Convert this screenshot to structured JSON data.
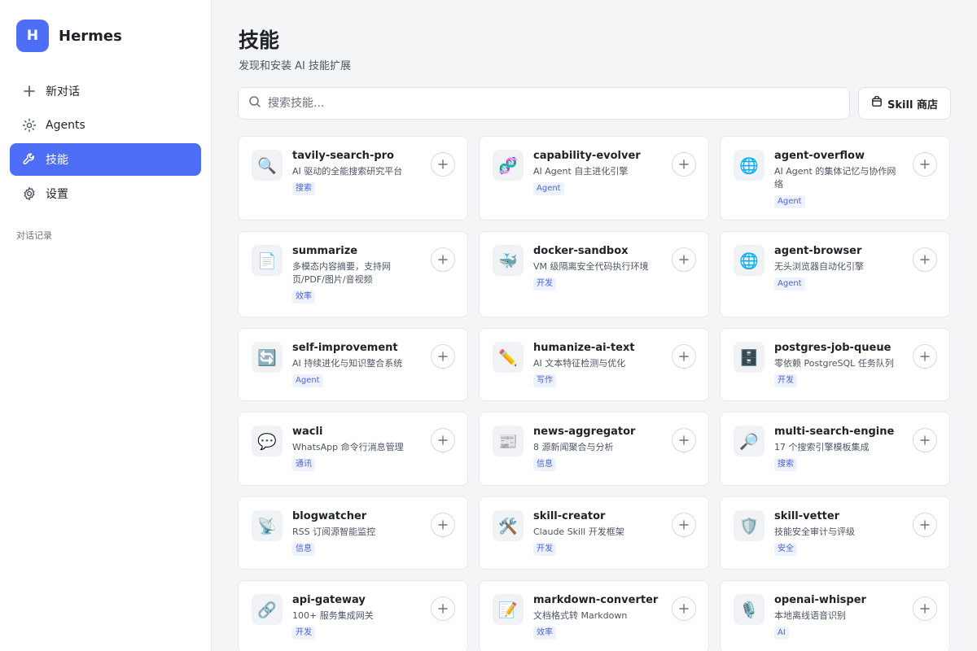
{
  "brand": {
    "logo_letter": "H",
    "name": "Hermes"
  },
  "nav": {
    "items": [
      {
        "label": "新对话",
        "icon": "plus-icon"
      },
      {
        "label": "Agents",
        "icon": "sun-icon"
      },
      {
        "label": "技能",
        "icon": "wrench-icon",
        "active": true
      },
      {
        "label": "设置",
        "icon": "gear-icon"
      }
    ],
    "history_label": "对话记录"
  },
  "page": {
    "title": "技能",
    "subtitle": "发现和安装 AI 技能扩展"
  },
  "search": {
    "placeholder": "搜索技能..."
  },
  "store_button": {
    "label": "Skill 商店"
  },
  "colors": {
    "accent": "#4f6ef7",
    "tag_bg": "#eef1fe",
    "tag_text": "#4a63d8"
  },
  "skills": [
    {
      "name": "tavily-search-pro",
      "desc": "AI 驱动的全能搜索研究平台",
      "tag": "搜索",
      "icon": "🔍",
      "icon_name": "magnifier-icon"
    },
    {
      "name": "capability-evolver",
      "desc": "AI Agent 自主进化引擎",
      "tag": "Agent",
      "icon": "🧬",
      "icon_name": "dna-icon"
    },
    {
      "name": "agent-overflow",
      "desc": "AI Agent 的集体记忆与协作网络",
      "tag": "Agent",
      "icon": "🌐",
      "icon_name": "globe-icon"
    },
    {
      "name": "summarize",
      "desc": "多模态内容摘要，支持网页/PDF/图片/音视频",
      "tag": "效率",
      "icon": "📄",
      "icon_name": "document-icon"
    },
    {
      "name": "docker-sandbox",
      "desc": "VM 级隔离安全代码执行环境",
      "tag": "开发",
      "icon": "🐳",
      "icon_name": "whale-icon"
    },
    {
      "name": "agent-browser",
      "desc": "无头浏览器自动化引擎",
      "tag": "Agent",
      "icon": "🌐",
      "icon_name": "globe-icon"
    },
    {
      "name": "self-improvement",
      "desc": "AI 持续进化与知识整合系统",
      "tag": "Agent",
      "icon": "🔄",
      "icon_name": "refresh-icon"
    },
    {
      "name": "humanize-ai-text",
      "desc": "AI 文本特征检测与优化",
      "tag": "写作",
      "icon": "✏️",
      "icon_name": "pencil-icon"
    },
    {
      "name": "postgres-job-queue",
      "desc": "零依赖 PostgreSQL 任务队列",
      "tag": "开发",
      "icon": "🗄️",
      "icon_name": "cabinet-icon"
    },
    {
      "name": "wacli",
      "desc": "WhatsApp 命令行消息管理",
      "tag": "通讯",
      "icon": "💬",
      "icon_name": "chat-bubble-icon"
    },
    {
      "name": "news-aggregator",
      "desc": "8 源新闻聚合与分析",
      "tag": "信息",
      "icon": "📰",
      "icon_name": "newspaper-icon"
    },
    {
      "name": "multi-search-engine",
      "desc": "17 个搜索引擎模板集成",
      "tag": "搜索",
      "icon": "🔎",
      "icon_name": "magnifier-icon"
    },
    {
      "name": "blogwatcher",
      "desc": "RSS 订阅源智能监控",
      "tag": "信息",
      "icon": "📡",
      "icon_name": "satellite-dish-icon"
    },
    {
      "name": "skill-creator",
      "desc": "Claude Skill 开发框架",
      "tag": "开发",
      "icon": "🛠️",
      "icon_name": "tools-icon"
    },
    {
      "name": "skill-vetter",
      "desc": "技能安全审计与评级",
      "tag": "安全",
      "icon": "🛡️",
      "icon_name": "shield-icon"
    },
    {
      "name": "api-gateway",
      "desc": "100+ 服务集成网关",
      "tag": "开发",
      "icon": "🔗",
      "icon_name": "link-icon"
    },
    {
      "name": "markdown-converter",
      "desc": "文档格式转 Markdown",
      "tag": "效率",
      "icon": "📝",
      "icon_name": "memo-icon"
    },
    {
      "name": "openai-whisper",
      "desc": "本地离线语音识别",
      "tag": "AI",
      "icon": "🎙️",
      "icon_name": "microphone-icon"
    }
  ]
}
